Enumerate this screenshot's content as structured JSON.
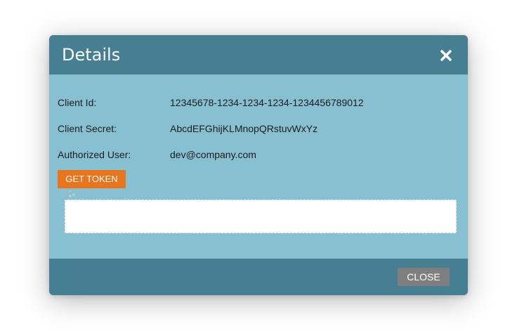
{
  "modal": {
    "title": "Details",
    "close_icon": "close-icon"
  },
  "fields": [
    {
      "label": "Client Id:",
      "value": "12345678-1234-1234-1234-1234456789012"
    },
    {
      "label": "Client Secret:",
      "value": "AbcdEFGhijKLMnopQRstuvWxYz"
    },
    {
      "label": "Authorized User:",
      "value": "dev@company.com"
    }
  ],
  "actions": {
    "get_token_label": "GET TOKEN",
    "close_label": "CLOSE"
  },
  "token_output": {
    "value": ""
  },
  "colors": {
    "header": "#457f91",
    "body": "#87c1d1",
    "accent": "#e8741c",
    "close_button": "#7f7f7f"
  }
}
